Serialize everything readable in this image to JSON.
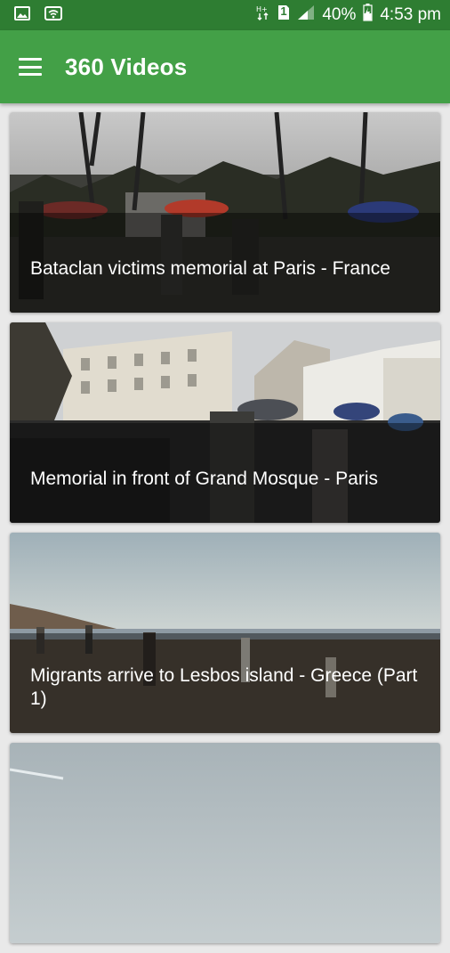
{
  "status_bar": {
    "icons_left": [
      "image-icon",
      "wifi-icon"
    ],
    "icons_right": [
      "network-type-icon",
      "sim-icon",
      "signal-icon",
      "battery-icon"
    ],
    "sim_label": "1",
    "battery": "40%",
    "time": "4:53 pm"
  },
  "app_bar": {
    "title": "360 Videos",
    "menu_icon": "hamburger-menu-icon"
  },
  "colors": {
    "status_bar": "#2e7d32",
    "app_bar": "#43a047",
    "background": "#e9e9e9"
  },
  "videos": [
    {
      "title": "Bataclan victims memorial at Paris - France"
    },
    {
      "title": "Memorial in front of Grand Mosque - Paris"
    },
    {
      "title": "Migrants arrive to Lesbos island - Greece (Part 1)"
    },
    {
      "title": ""
    }
  ]
}
